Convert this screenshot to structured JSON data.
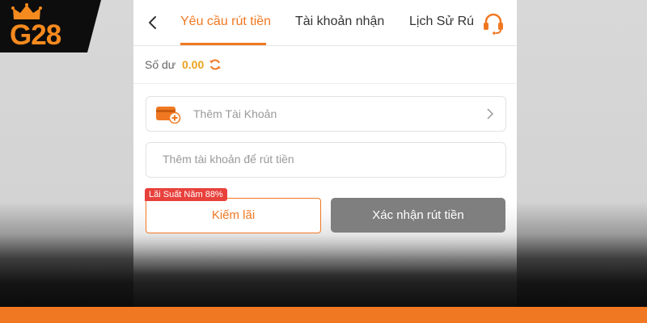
{
  "brand": {
    "logo_text": "G28",
    "accent_color": "#f07822"
  },
  "header": {
    "tabs": [
      {
        "label": "Yêu cầu rút tiền",
        "active": true
      },
      {
        "label": "Tài khoản nhận",
        "active": false
      },
      {
        "label": "Lịch Sử Rú",
        "active": false
      }
    ],
    "back_icon": "chevron-left-icon",
    "support_icon": "headset-icon"
  },
  "balance": {
    "label": "Số dư",
    "value": "0.00",
    "refresh_icon": "refresh-icon"
  },
  "account": {
    "label": "Thêm Tài Khoản",
    "icon": "card-add-icon"
  },
  "withdraw_input": {
    "placeholder": "Thêm tài khoản để rút tiền",
    "value": ""
  },
  "actions": {
    "badge": "Lãi Suất Năm 88%",
    "earn_label": "Kiếm lãi",
    "confirm_label": "Xác nhận rút tiền"
  }
}
